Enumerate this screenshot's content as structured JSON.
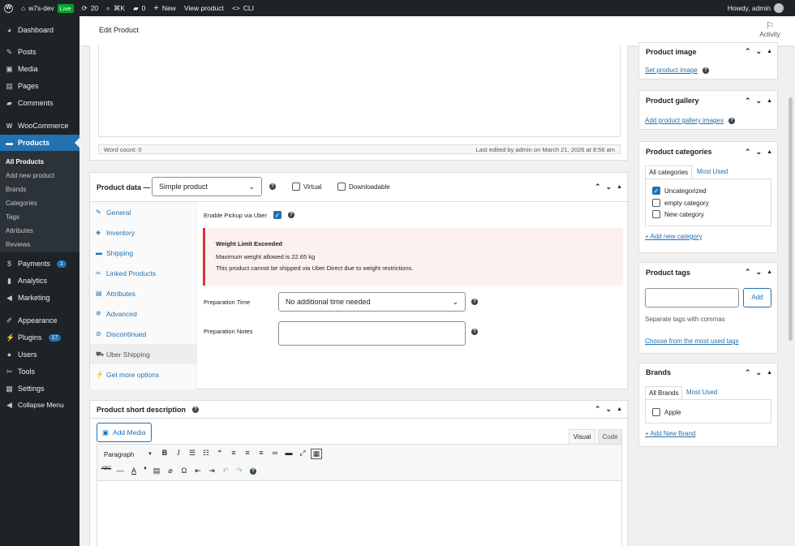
{
  "adminbar": {
    "site_name": "w7s-dev",
    "live_label": "Live",
    "updates_count": "20",
    "search_shortcut": "⌘K",
    "comments_count": "0",
    "new_label": "New",
    "view_product": "View product",
    "cli_label": "CLI",
    "howdy": "Howdy, admin"
  },
  "sidebar": {
    "items": [
      {
        "label": "Dashboard",
        "icon": "dashboard-icon"
      },
      {
        "label": "Posts",
        "icon": "pin-icon"
      },
      {
        "label": "Media",
        "icon": "media-icon"
      },
      {
        "label": "Pages",
        "icon": "pages-icon"
      },
      {
        "label": "Comments",
        "icon": "comment-icon"
      },
      {
        "label": "WooCommerce",
        "icon": "woo-icon"
      },
      {
        "label": "Products",
        "icon": "archive-icon"
      },
      {
        "label": "Payments",
        "icon": "payments-icon",
        "badge": "1"
      },
      {
        "label": "Analytics",
        "icon": "chart-icon"
      },
      {
        "label": "Marketing",
        "icon": "megaphone-icon"
      },
      {
        "label": "Appearance",
        "icon": "brush-icon"
      },
      {
        "label": "Plugins",
        "icon": "plugin-icon",
        "badge": "17"
      },
      {
        "label": "Users",
        "icon": "users-icon"
      },
      {
        "label": "Tools",
        "icon": "wrench-icon"
      },
      {
        "label": "Settings",
        "icon": "settings-icon"
      },
      {
        "label": "Collapse Menu",
        "icon": "collapse-icon"
      }
    ],
    "products_sub": [
      "All Products",
      "Add new product",
      "Brands",
      "Categories",
      "Tags",
      "Attributes",
      "Reviews"
    ]
  },
  "header": {
    "title": "Edit Product",
    "activity": "Activity"
  },
  "editor": {
    "word_count": "Word count: 0",
    "last_edited": "Last edited by admin on March 21, 2026 at 8:56 am"
  },
  "product_data": {
    "title": "Product data —",
    "type_selected": "Simple product",
    "virtual_label": "Virtual",
    "downloadable_label": "Downloadable",
    "tabs": [
      {
        "label": "General",
        "icon": "wrench-icon"
      },
      {
        "label": "Inventory",
        "icon": "tag-icon"
      },
      {
        "label": "Shipping",
        "icon": "truck-icon"
      },
      {
        "label": "Linked Products",
        "icon": "link-icon"
      },
      {
        "label": "Attributes",
        "icon": "list-icon"
      },
      {
        "label": "Advanced",
        "icon": "gear-icon"
      },
      {
        "label": "Discontinued",
        "icon": "block-icon"
      },
      {
        "label": "Uber Shipping",
        "icon": "car-icon"
      },
      {
        "label": "Get more options",
        "icon": "plugin-icon"
      }
    ],
    "enable_pickup_label": "Enable Pickup via Uber",
    "warning_title": "Weight Limit Exceeded",
    "warning_line1": "Maximum weight allowed is 22.65 kg",
    "warning_line2": "This product cannot be shipped via Uber Direct due to weight restrictions.",
    "prep_time_label": "Preparation Time",
    "prep_time_value": "No additional time needed",
    "prep_notes_label": "Preparation Notes"
  },
  "short_desc": {
    "title": "Product short description",
    "add_media": "Add Media",
    "tab_visual": "Visual",
    "tab_code": "Code",
    "format": "Paragraph"
  },
  "right": {
    "image_title": "Product image",
    "set_image": "Set product image",
    "gallery_title": "Product gallery",
    "add_gallery": "Add product gallery images",
    "categories_title": "Product categories",
    "cat_tab_all": "All categories",
    "cat_tab_used": "Most Used",
    "categories": [
      {
        "label": "Uncategorized",
        "checked": true
      },
      {
        "label": "empty category",
        "checked": false
      },
      {
        "label": "New category",
        "checked": false
      }
    ],
    "add_category": "+ Add new category",
    "tags_title": "Product tags",
    "tags_add": "Add",
    "tags_hint": "Separate tags with commas",
    "tags_choose": "Choose from the most used tags",
    "brands_title": "Brands",
    "brands_tab_all": "All Brands",
    "brands_tab_used": "Most Used",
    "brands": [
      {
        "label": "Apple",
        "checked": false
      }
    ],
    "add_brand": "+ Add New Brand"
  }
}
